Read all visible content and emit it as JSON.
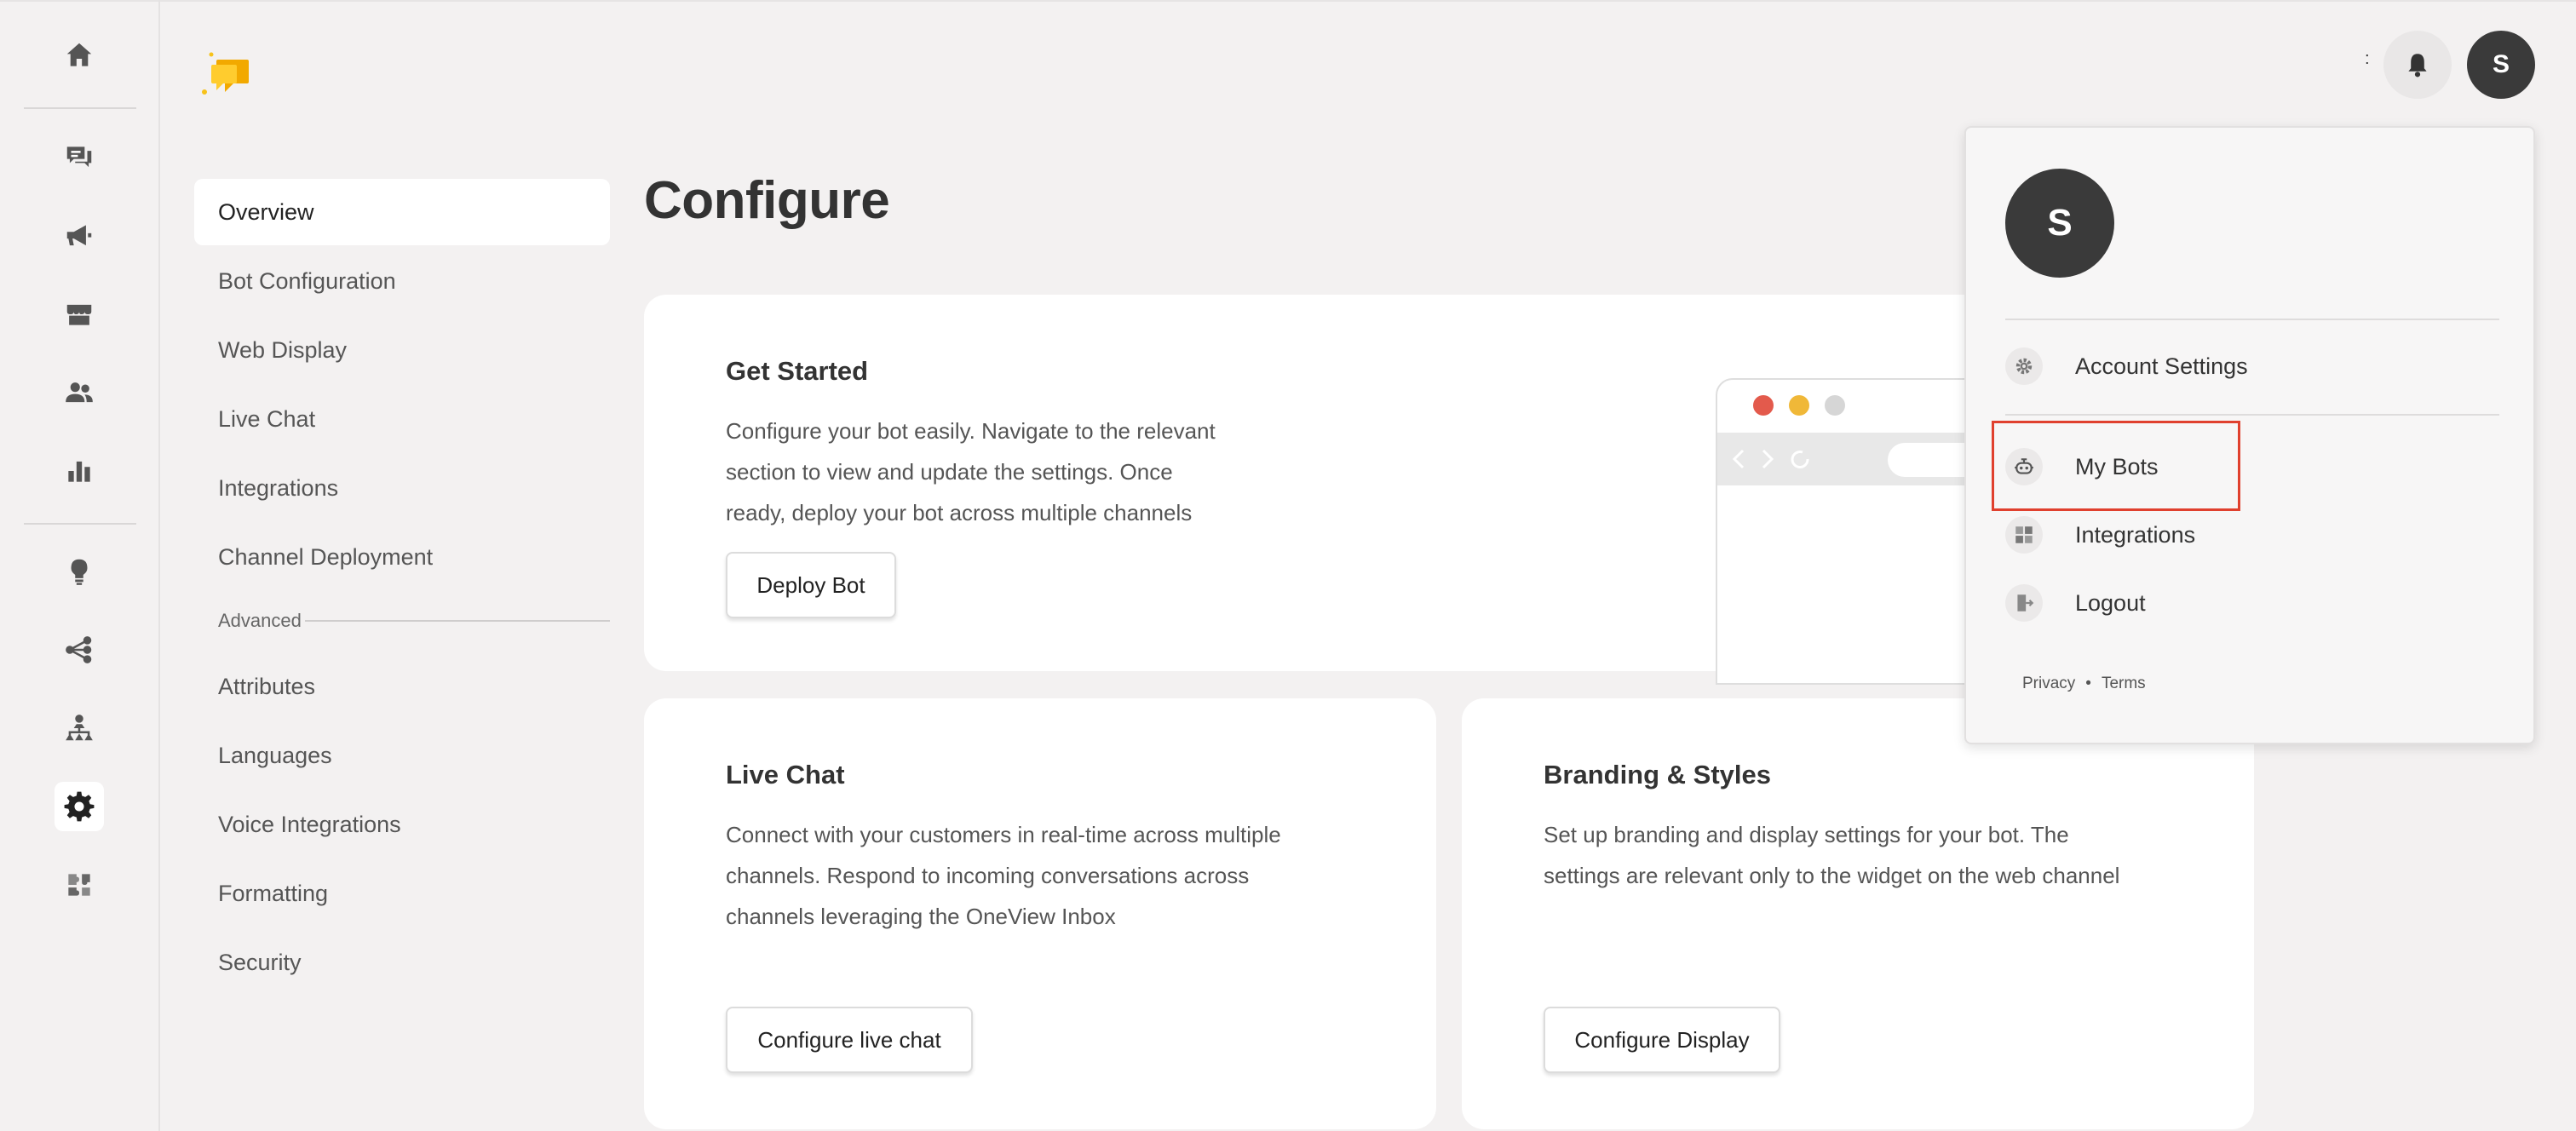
{
  "colors": {
    "accent": "#f7c21a",
    "avatar_bg": "#3a3a3a",
    "highlight": "#e0402e"
  },
  "rail": {
    "icons": [
      "home-icon",
      "conversations-icon",
      "megaphone-icon",
      "store-icon",
      "users-icon",
      "analytics-icon",
      "lightbulb-icon",
      "flow-icon",
      "hierarchy-icon",
      "gear-icon",
      "puzzle-icon"
    ],
    "active": "gear-icon"
  },
  "nav": {
    "items": [
      "Overview",
      "Bot Configuration",
      "Web Display",
      "Live Chat",
      "Integrations",
      "Channel Deployment"
    ],
    "section_label": "Advanced",
    "advanced_items": [
      "Attributes",
      "Languages",
      "Voice Integrations",
      "Formatting",
      "Security"
    ]
  },
  "main": {
    "title": "Configure",
    "get_started": {
      "title": "Get Started",
      "desc_lines": [
        "Configure your bot easily. Navigate to the relevant",
        "section to view and update the settings. Once",
        "ready, deploy your bot across multiple channels"
      ],
      "button": "Deploy Bot"
    },
    "live_chat": {
      "title": "Live Chat",
      "desc_lines": [
        "Connect with your customers in real-time across multiple",
        "channels. Respond to incoming conversations across",
        "channels leveraging the OneView Inbox"
      ],
      "button": "Configure live chat"
    },
    "branding": {
      "title": "Branding & Styles",
      "desc_lines": [
        "Set up branding and display settings for your bot. The",
        "settings are relevant only to the widget on the web channel"
      ],
      "button": "Configure Display"
    }
  },
  "header": {
    "avatar_initial": "S",
    "truncated": ":"
  },
  "dropdown": {
    "avatar_initial": "S",
    "items": [
      "Account Settings",
      "My Bots",
      "Integrations",
      "Logout"
    ],
    "footer": {
      "privacy": "Privacy",
      "separator": "•",
      "terms": "Terms"
    }
  }
}
